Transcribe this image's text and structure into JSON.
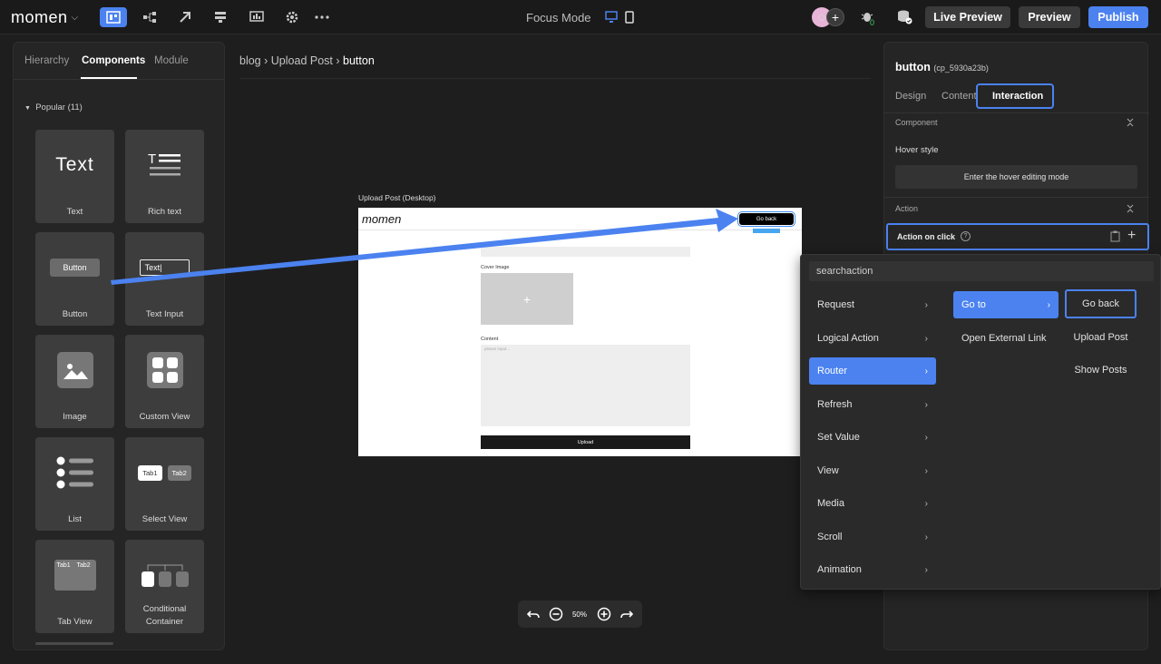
{
  "topbar": {
    "logo": "momen",
    "focus_mode": "Focus Mode",
    "live_preview": "Live Preview",
    "preview": "Preview",
    "publish": "Publish",
    "notification_count": "0"
  },
  "left_panel": {
    "tabs": [
      {
        "label": "Hierarchy"
      },
      {
        "label": "Components"
      },
      {
        "label": "Module"
      }
    ],
    "popular_label": "Popular (11)",
    "components": [
      {
        "label": "Text",
        "visual": "Text"
      },
      {
        "label": "Rich text"
      },
      {
        "label": "Button",
        "visual": "Button"
      },
      {
        "label": "Text Input",
        "visual": "Text"
      },
      {
        "label": "Image"
      },
      {
        "label": "Custom View"
      },
      {
        "label": "List"
      },
      {
        "label": "Select View",
        "tab1": "Tab1",
        "tab2": "Tab2"
      },
      {
        "label": "Tab View",
        "tab1": "Tab1",
        "tab2": "Tab2"
      },
      {
        "label_line1": "Conditional",
        "label_line2": "Container"
      }
    ]
  },
  "breadcrumb": {
    "part1": "blog",
    "part2": "Upload Post",
    "current": "button"
  },
  "artboard": {
    "title": "Upload Post (Desktop)",
    "logo": "momen",
    "go_back": "Go back",
    "cover_image": "Cover Image",
    "content": "Content",
    "content_placeholder": "please input...",
    "upload": "Upload"
  },
  "zoom": {
    "level": "50%"
  },
  "right_panel": {
    "title": "button",
    "id": "(cp_5930a23b)",
    "tabs": [
      {
        "label": "Design"
      },
      {
        "label": "Content"
      },
      {
        "label": "Interaction"
      }
    ],
    "component_section": "Component",
    "hover_style": "Hover style",
    "hover_button": "Enter the hover editing mode",
    "action_section": "Action",
    "action_on_click": "Action on click"
  },
  "dropdown": {
    "search_placeholder": "searchaction",
    "categories": [
      {
        "label": "Request"
      },
      {
        "label": "Logical Action"
      },
      {
        "label": "Router"
      },
      {
        "label": "Refresh"
      },
      {
        "label": "Set Value"
      },
      {
        "label": "View"
      },
      {
        "label": "Media"
      },
      {
        "label": "Scroll"
      },
      {
        "label": "Animation"
      }
    ],
    "router_items": [
      {
        "label": "Go to"
      },
      {
        "label": "Open External Link"
      }
    ],
    "goto_items": [
      {
        "label": "Go back"
      },
      {
        "label": "Upload Post"
      },
      {
        "label": "Show Posts"
      }
    ]
  },
  "colors": {
    "accent": "#4b82f0",
    "background": "#1e1e1e",
    "panel": "#252525"
  }
}
